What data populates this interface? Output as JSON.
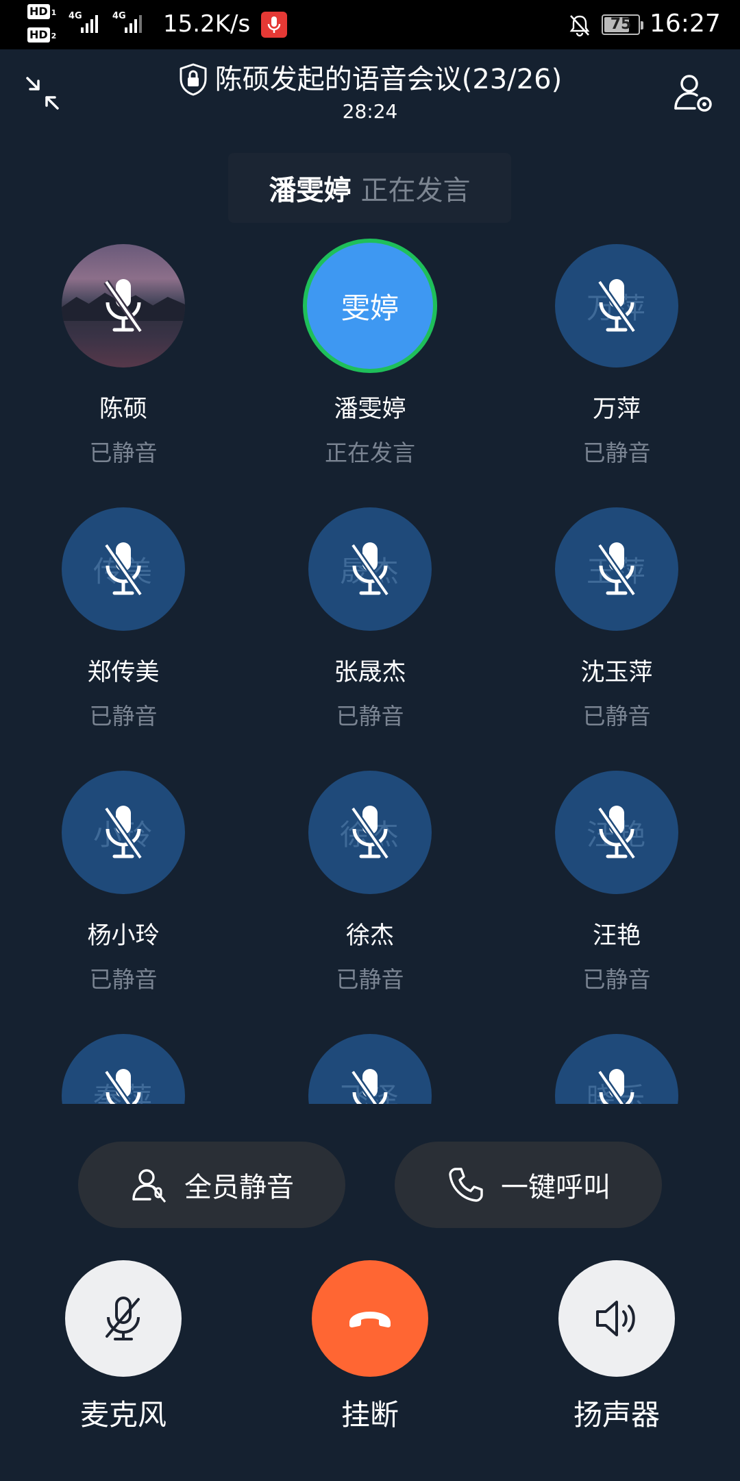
{
  "status_bar": {
    "hd1": "HD",
    "hd1_sub": "1",
    "hd2": "HD",
    "hd2_sub": "2",
    "network1": "4G",
    "network2": "4G",
    "speed": "15.2K/s",
    "battery": "75",
    "battery_level": 0.75,
    "time": "16:27"
  },
  "header": {
    "title": "陈硕发起的语音会议(23/26)",
    "duration": "28:24"
  },
  "speaking_banner": {
    "name": "潘雯婷",
    "state": "正在发言"
  },
  "participants": [
    {
      "name": "陈硕",
      "status": "已静音",
      "avatar_text": "",
      "avatar": "photo",
      "muted": true
    },
    {
      "name": "潘雯婷",
      "status": "正在发言",
      "avatar_text": "雯婷",
      "avatar": "active",
      "muted": false
    },
    {
      "name": "万萍",
      "status": "已静音",
      "avatar_text": "万萍",
      "avatar": "initials",
      "muted": true
    },
    {
      "name": "郑传美",
      "status": "已静音",
      "avatar_text": "传美",
      "avatar": "initials",
      "muted": true
    },
    {
      "name": "张晟杰",
      "status": "已静音",
      "avatar_text": "晟杰",
      "avatar": "initials",
      "muted": true
    },
    {
      "name": "沈玉萍",
      "status": "已静音",
      "avatar_text": "玉萍",
      "avatar": "initials",
      "muted": true
    },
    {
      "name": "杨小玲",
      "status": "已静音",
      "avatar_text": "小玲",
      "avatar": "initials",
      "muted": true
    },
    {
      "name": "徐杰",
      "status": "已静音",
      "avatar_text": "徐杰",
      "avatar": "initials",
      "muted": true
    },
    {
      "name": "汪艳",
      "status": "已静音",
      "avatar_text": "汪艳",
      "avatar": "initials",
      "muted": true
    },
    {
      "name": "",
      "status": "",
      "avatar_text": "秦萍",
      "avatar": "initials",
      "muted": true
    },
    {
      "name": "",
      "status": "",
      "avatar_text": "飞泽",
      "avatar": "initials",
      "muted": true
    },
    {
      "name": "",
      "status": "",
      "avatar_text": "晓乐",
      "avatar": "initials",
      "muted": true
    }
  ],
  "actions": {
    "mute_all": "全员静音",
    "call_all": "一键呼叫"
  },
  "controls": {
    "microphone": "麦克风",
    "hangup": "挂断",
    "speaker": "扬声器"
  },
  "colors": {
    "background": "#152130",
    "avatar_bg": "#1f4a7a",
    "active_avatar": "#3e98f2",
    "speaking_ring": "#1fbf5a",
    "hangup": "#ff6633",
    "pill_bg": "#2a2f36",
    "muted_text": "#7a8492"
  }
}
